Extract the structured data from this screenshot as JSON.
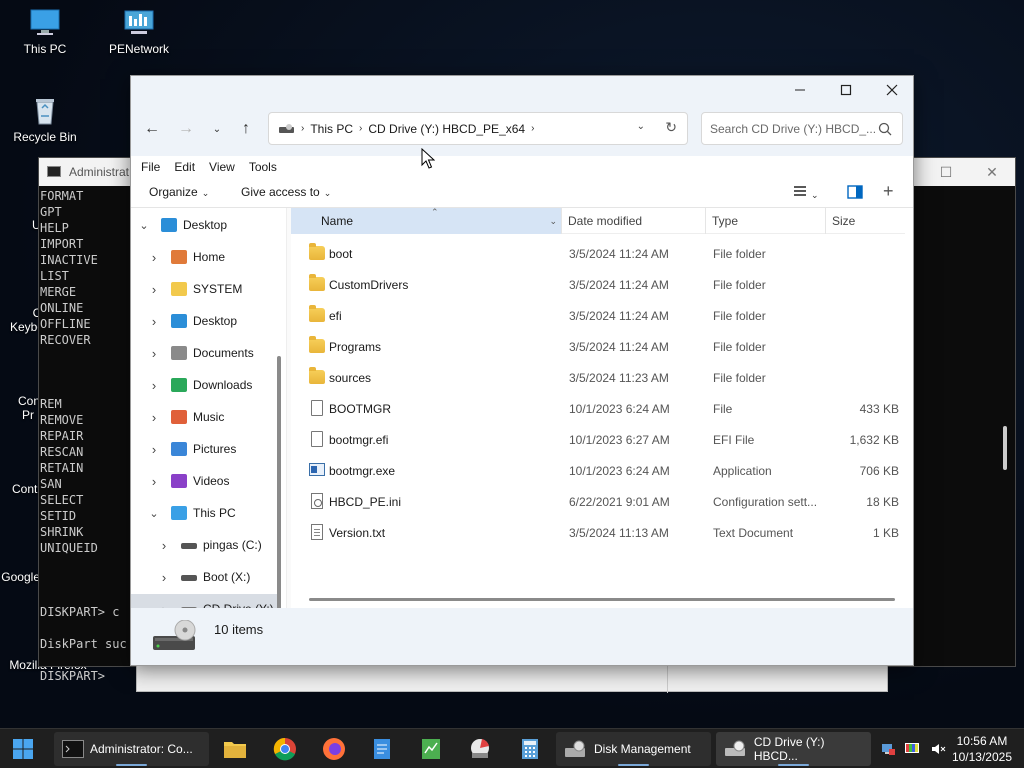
{
  "desktop": {
    "icons": [
      {
        "label": "This PC"
      },
      {
        "label": "PENetwork"
      },
      {
        "label": "Recycle Bin"
      },
      {
        "label": "Ut"
      },
      {
        "label": "Ch"
      },
      {
        "label": "Keybo"
      },
      {
        "label": "Con"
      },
      {
        "label": "Pr"
      },
      {
        "label": "Conti"
      },
      {
        "label": "Google"
      },
      {
        "label": "Mozilla Firefox"
      }
    ]
  },
  "console": {
    "title": "Administrat",
    "lines": "FORMAT\nGPT\nHELP\nIMPORT\nINACTIVE\nLIST\nMERGE\nONLINE\nOFFLINE\nRECOVER\n\n\n\nREM\nREMOVE\nREPAIR\nRESCAN\nRETAIN\nSAN\nSELECT\nSETID\nSHRINK\nUNIQUEID\n\n\n\nDISKPART> c\n\nDiskPart suc\n\nDISKPART> "
  },
  "explorer": {
    "address": {
      "crumbs": [
        "This PC",
        "CD Drive (Y:) HBCD_PE_x64"
      ]
    },
    "search_placeholder": "Search CD Drive (Y:) HBCD_...",
    "menu": [
      "File",
      "Edit",
      "View",
      "Tools"
    ],
    "commands": {
      "organize": "Organize",
      "give_access": "Give access to"
    },
    "nav": [
      {
        "label": "Desktop",
        "icon": "desktop-icon",
        "expander": "down"
      },
      {
        "label": "Home",
        "icon": "home-icon",
        "expander": "right"
      },
      {
        "label": "SYSTEM",
        "icon": "folder-icon",
        "expander": "right"
      },
      {
        "label": "Desktop",
        "icon": "desktop-icon",
        "expander": "right"
      },
      {
        "label": "Documents",
        "icon": "documents-icon",
        "expander": "right"
      },
      {
        "label": "Downloads",
        "icon": "downloads-icon",
        "expander": "right"
      },
      {
        "label": "Music",
        "icon": "music-icon",
        "expander": "right"
      },
      {
        "label": "Pictures",
        "icon": "pictures-icon",
        "expander": "right"
      },
      {
        "label": "Videos",
        "icon": "videos-icon",
        "expander": "right"
      },
      {
        "label": "This PC",
        "icon": "pc-icon",
        "expander": "down"
      },
      {
        "label": "pingas (C:)",
        "icon": "drive-icon",
        "expander": "right"
      },
      {
        "label": "Boot (X:)",
        "icon": "drive-icon",
        "expander": "right"
      },
      {
        "label": "CD Drive (Y:)",
        "icon": "cd-drive-icon",
        "expander": "right"
      }
    ],
    "columns": {
      "name": "Name",
      "date": "Date modified",
      "type": "Type",
      "size": "Size"
    },
    "files": [
      {
        "name": "boot",
        "date": "3/5/2024 11:24 AM",
        "type": "File folder",
        "size": "",
        "icon": "folder-icon"
      },
      {
        "name": "CustomDrivers",
        "date": "3/5/2024 11:24 AM",
        "type": "File folder",
        "size": "",
        "icon": "folder-icon"
      },
      {
        "name": "efi",
        "date": "3/5/2024 11:24 AM",
        "type": "File folder",
        "size": "",
        "icon": "folder-icon"
      },
      {
        "name": "Programs",
        "date": "3/5/2024 11:24 AM",
        "type": "File folder",
        "size": "",
        "icon": "folder-icon"
      },
      {
        "name": "sources",
        "date": "3/5/2024 11:23 AM",
        "type": "File folder",
        "size": "",
        "icon": "folder-icon"
      },
      {
        "name": "BOOTMGR",
        "date": "10/1/2023 6:24 AM",
        "type": "File",
        "size": "433 KB",
        "icon": "file-icon"
      },
      {
        "name": "bootmgr.efi",
        "date": "10/1/2023 6:27 AM",
        "type": "EFI File",
        "size": "1,632 KB",
        "icon": "file-icon"
      },
      {
        "name": "bootmgr.exe",
        "date": "10/1/2023 6:24 AM",
        "type": "Application",
        "size": "706 KB",
        "icon": "application-icon"
      },
      {
        "name": "HBCD_PE.ini",
        "date": "6/22/2021 9:01 AM",
        "type": "Configuration sett...",
        "size": "18 KB",
        "icon": "settings-file-icon"
      },
      {
        "name": "Version.txt",
        "date": "3/5/2024 11:13 AM",
        "type": "Text Document",
        "size": "1 KB",
        "icon": "text-file-icon"
      }
    ],
    "status": {
      "count": "10 items"
    }
  },
  "taskbar": {
    "apps": [
      {
        "label": "Administrator: Co..."
      },
      {
        "label": "Disk Management"
      },
      {
        "label": "CD Drive (Y:) HBCD..."
      }
    ],
    "clock": {
      "time": "10:56 AM",
      "date": "10/13/2025"
    }
  },
  "colors": {
    "accent": "#0067c0",
    "selection": "#d6e4f5",
    "taskbar": "#1f1f1f"
  }
}
